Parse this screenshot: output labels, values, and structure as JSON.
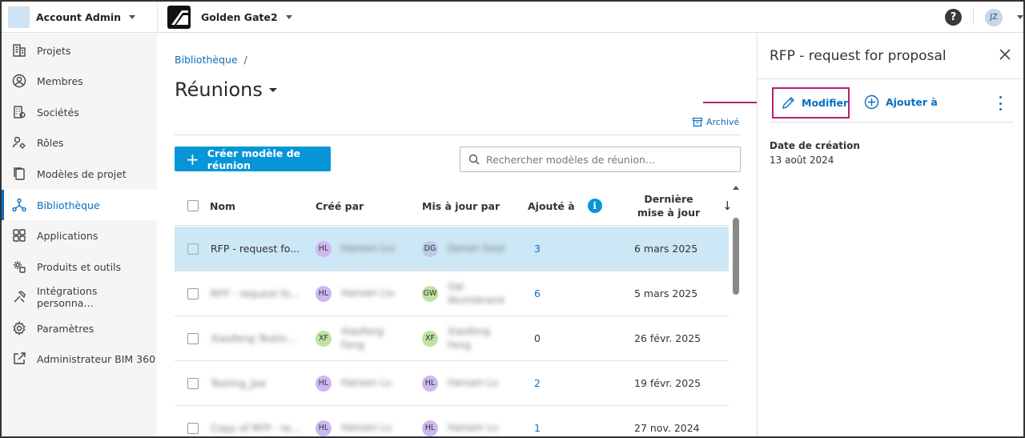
{
  "topbar": {
    "account_name": "Account Admin",
    "project_name": "Golden Gate2",
    "help_label": "?",
    "user_initials": "JZ"
  },
  "sidebar": {
    "items": [
      {
        "label": "Projets",
        "icon": "building-icon",
        "active": false
      },
      {
        "label": "Membres",
        "icon": "user-circle-icon",
        "active": false
      },
      {
        "label": "Sociétés",
        "icon": "company-icon",
        "active": false
      },
      {
        "label": "Rôles",
        "icon": "user-gear-icon",
        "active": false
      },
      {
        "label": "Modèles de projet",
        "icon": "template-icon",
        "active": false
      },
      {
        "label": "Bibliothèque",
        "icon": "library-icon",
        "active": true
      },
      {
        "label": "Applications",
        "icon": "apps-grid-icon",
        "active": false
      },
      {
        "label": "Produits et outils",
        "icon": "gear-box-icon",
        "active": false
      },
      {
        "label": "Intégrations personna…",
        "icon": "tools-icon",
        "active": false
      },
      {
        "label": "Paramètres",
        "icon": "settings-icon",
        "active": false
      },
      {
        "label": "Administrateur BIM 360",
        "icon": "external-link-icon",
        "active": false
      }
    ]
  },
  "main": {
    "breadcrumb": "Bibliothèque",
    "breadcrumb_sep": "/",
    "title": "Réunions",
    "archive_label": "Archivé",
    "create_button": "Créer modèle de réunion",
    "search_placeholder": "Rechercher modèles de réunion...",
    "columns": {
      "name": "Nom",
      "created_by": "Créé par",
      "updated_by": "Mis à jour par",
      "added_to": "Ajouté à",
      "last_update": "Dernière mise à jour"
    },
    "rows": [
      {
        "name": "RFP - request fo...",
        "created_initials": "HL",
        "created_name": "Hansen Liu",
        "created_color": "#cdb8f2",
        "updated_initials": "DG",
        "updated_name": "Donon Gour",
        "updated_color": "#b9c9e6",
        "added": "3",
        "added_link": true,
        "date": "6 mars 2025",
        "selected": true,
        "blur_name": false
      },
      {
        "name": "RFP - request fo...",
        "created_initials": "HL",
        "created_name": "Hansen Liu",
        "created_color": "#cdb8f2",
        "updated_initials": "GW",
        "updated_name": "Gal Wurmbrand",
        "updated_color": "#bfe3a1",
        "added": "6",
        "added_link": true,
        "date": "5 mars 2025",
        "selected": false,
        "blur_name": true
      },
      {
        "name": "Xiaofeng Testin...",
        "created_initials": "XF",
        "created_name": "Xiaofeng Feng",
        "created_color": "#bfe3a1",
        "updated_initials": "XF",
        "updated_name": "Xiaofeng Feng",
        "updated_color": "#bfe3a1",
        "added": "0",
        "added_link": false,
        "date": "26 févr. 2025",
        "selected": false,
        "blur_name": true
      },
      {
        "name": "Testing_Joe",
        "created_initials": "HL",
        "created_name": "Hansen Lu",
        "created_color": "#cdb8f2",
        "updated_initials": "HL",
        "updated_name": "Hansen Lu",
        "updated_color": "#cdb8f2",
        "added": "2",
        "added_link": true,
        "date": "19 févr. 2025",
        "selected": false,
        "blur_name": true
      },
      {
        "name": "Copy of RFP - re...",
        "created_initials": "HL",
        "created_name": "Hansen Lu",
        "created_color": "#cdb8f2",
        "updated_initials": "HL",
        "updated_name": "Hansen Lu",
        "updated_color": "#cdb8f2",
        "added": "1",
        "added_link": true,
        "date": "27 nov. 2024",
        "selected": false,
        "blur_name": true
      }
    ]
  },
  "panel": {
    "title": "RFP - request for proposal",
    "modify_label": "Modifier",
    "add_label": "Ajouter à",
    "date_label": "Date de création",
    "date_value": "13 août 2024"
  },
  "colors": {
    "accent": "#0696d7",
    "link": "#0a6ec0",
    "callout": "#b3206f",
    "selected_row": "#cce7f5"
  }
}
